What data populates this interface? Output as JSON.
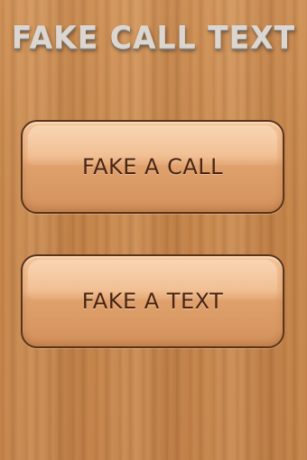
{
  "app": {
    "title": "FAKE CALL TEXT"
  },
  "buttons": {
    "fake_call_label": "FAKE A CALL",
    "fake_text_label": "FAKE A TEXT"
  },
  "colors": {
    "background_wood": "#c8884e",
    "button_fill": "#efb787",
    "button_border": "#5b331a",
    "button_text": "#4a2412",
    "title_text": "#dcd6d0"
  }
}
